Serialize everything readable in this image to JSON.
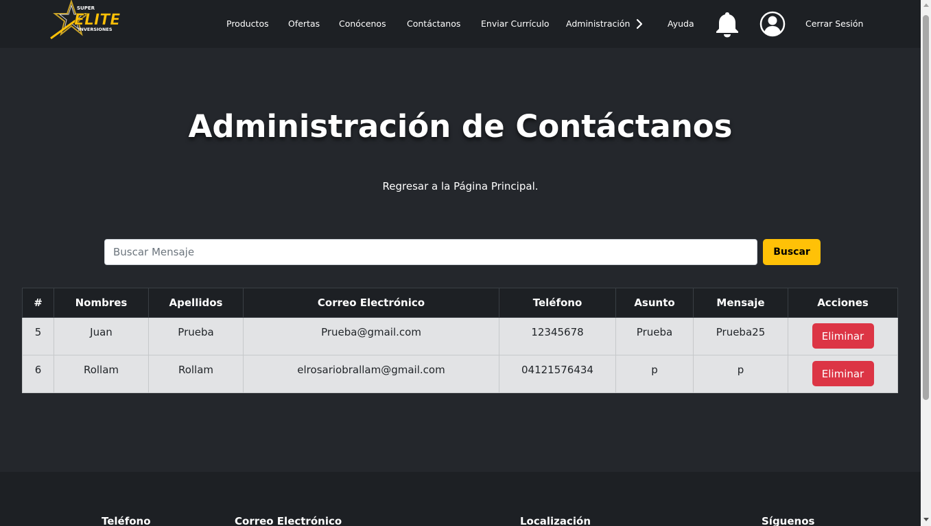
{
  "brand": {
    "logo_top": "SUPER",
    "logo_main": "ELITE",
    "logo_bottom": "INVERSIONES",
    "accent_color": "#ffc107"
  },
  "nav": {
    "items": [
      {
        "label": "Productos"
      },
      {
        "label": "Ofertas"
      },
      {
        "label": "Conócenos"
      },
      {
        "label": "Contáctanos"
      },
      {
        "label": "Enviar Currículo"
      },
      {
        "label": "Administración"
      },
      {
        "label": "Ayuda"
      }
    ],
    "logout": "Cerrar Sesión",
    "icons": [
      "chevron-right-icon",
      "bell-icon",
      "user-circle-icon"
    ]
  },
  "page": {
    "title": "Administración de Contáctanos",
    "back_link": "Regresar a la Página Principal."
  },
  "search": {
    "placeholder": "Buscar Mensaje",
    "value": "",
    "button": "Buscar"
  },
  "table": {
    "headers": [
      "#",
      "Nombres",
      "Apellidos",
      "Correo Electrónico",
      "Teléfono",
      "Asunto",
      "Mensaje",
      "Acciones"
    ],
    "rows": [
      {
        "id": "5",
        "nombres": "Juan",
        "apellidos": "Prueba",
        "correo": "Prueba@gmail.com",
        "telefono": "12345678",
        "asunto": "Prueba",
        "mensaje": "Prueba25",
        "accion": "Eliminar"
      },
      {
        "id": "6",
        "nombres": "Rollam",
        "apellidos": "Rollam",
        "correo": "elrosariobrallam@gmail.com",
        "telefono": "04121576434",
        "asunto": "p",
        "mensaje": "p",
        "accion": "Eliminar"
      }
    ],
    "delete_color": "#dc3545"
  },
  "footer": {
    "headings": [
      "Teléfono",
      "Correo Electrónico",
      "Localización",
      "Síguenos"
    ]
  }
}
